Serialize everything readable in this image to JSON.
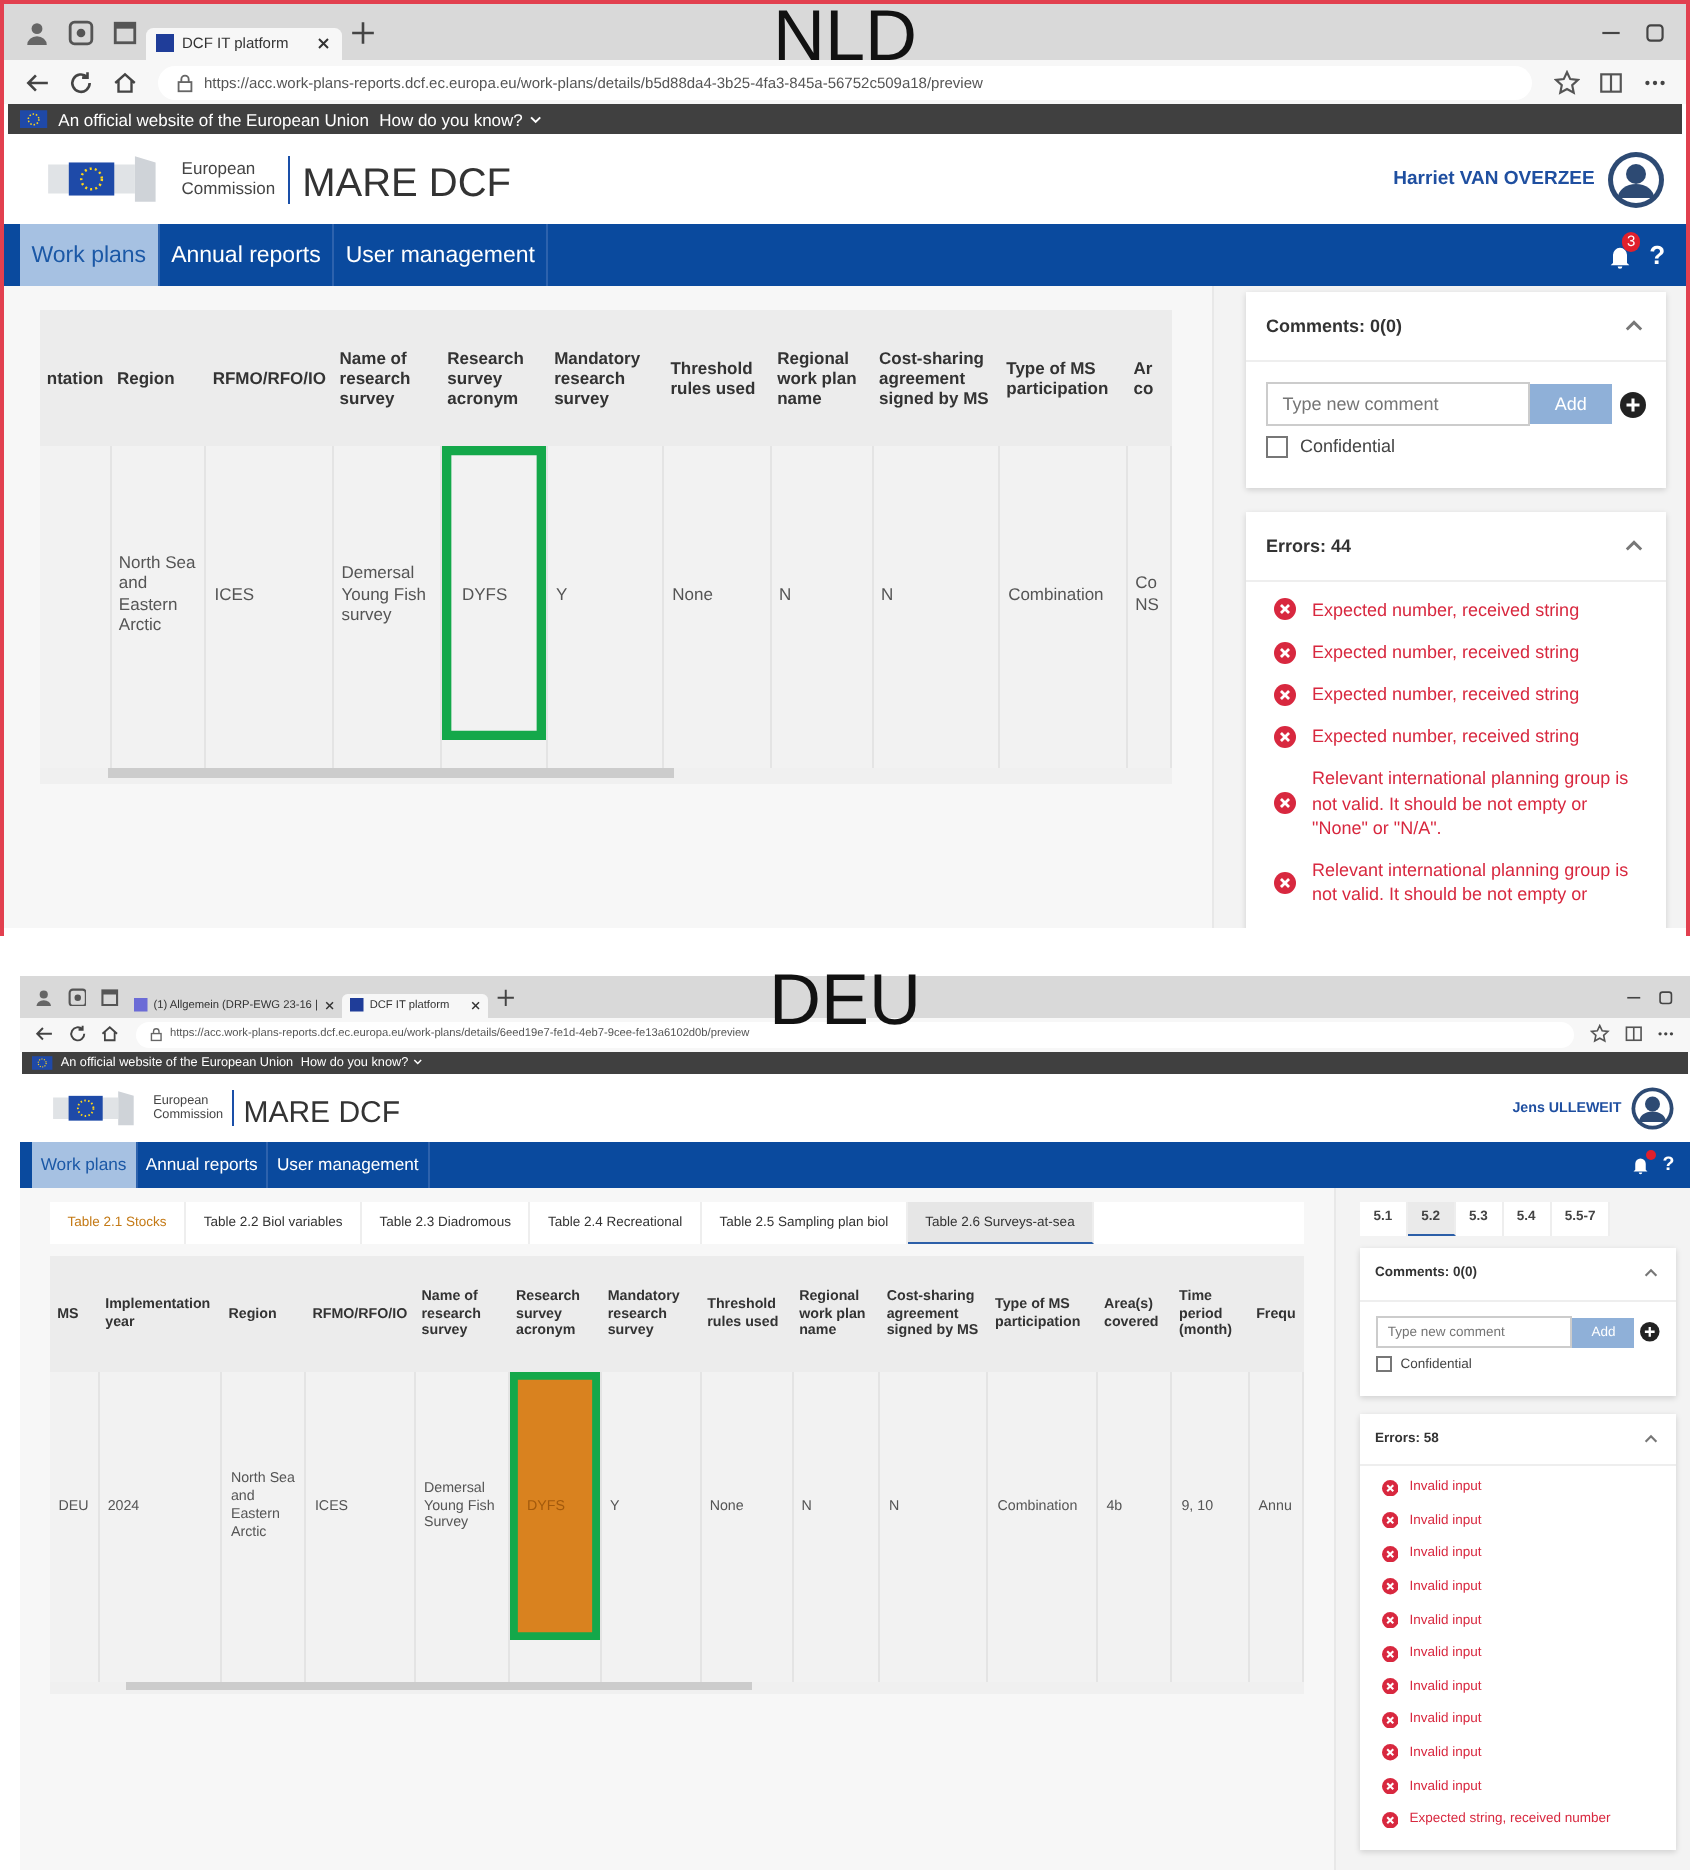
{
  "panels": [
    {
      "label": "NLD",
      "browser": {
        "tabs": [
          {
            "title": "DCF IT platform",
            "selected": true
          }
        ],
        "url": "https://acc.work-plans-reports.dcf.ec.europa.eu/work-plans/details/b5d88da4-3b25-4fa3-845a-56752c509a18/preview"
      },
      "eu_banner": {
        "text": "An official website of the European Union",
        "link": "How do you know?"
      },
      "header": {
        "org_line_1": "European",
        "org_line_2": "Commission",
        "app_title": "MARE DCF",
        "user": "Harriet VAN OVERZEE"
      },
      "nav": {
        "items": [
          {
            "label": "Work plans",
            "selected": true
          },
          {
            "label": "Annual reports",
            "selected": false
          },
          {
            "label": "User management",
            "selected": false
          }
        ],
        "badge": "3",
        "help": "?"
      },
      "table": {
        "columns": [
          "ntation",
          "Region",
          "RFMO/RFO/IO",
          "Name of research survey",
          "Research survey acronym",
          "Mandatory research survey",
          "Threshold rules used",
          "Regional work plan name",
          "Cost-sharing agreement signed by MS",
          "Type of MS participation",
          "Ar co"
        ],
        "rows": [
          {
            "cells": [
              {
                "text": "",
                "marked": false,
                "error": false
              },
              {
                "text": "North Sea and Eastern Arctic",
                "marked": false,
                "error": false
              },
              {
                "text": "ICES",
                "marked": false,
                "error": false
              },
              {
                "text": "Demersal Young Fish survey",
                "marked": false,
                "error": false
              },
              {
                "text": "DYFS",
                "marked": true,
                "error": false
              },
              {
                "text": "Y",
                "marked": false,
                "error": false
              },
              {
                "text": "None",
                "marked": false,
                "error": false
              },
              {
                "text": "N",
                "marked": false,
                "error": false
              },
              {
                "text": "N",
                "marked": false,
                "error": false
              },
              {
                "text": "Combination",
                "marked": false,
                "error": false
              },
              {
                "text": "Co NS",
                "marked": false,
                "error": false
              }
            ]
          }
        ]
      },
      "sidebar": {
        "comments": {
          "title": "Comments: 0(0)",
          "placeholder": "Type new comment",
          "add": "Add",
          "confidential": {
            "label": "Confidential",
            "checked": false
          }
        },
        "errors": {
          "title": "Errors: 44",
          "items": [
            "Expected number, received string",
            "Expected number, received string",
            "Expected number, received string",
            "Expected number, received string",
            "Relevant international planning group is not valid. It should be not empty or \"None\" or \"N/A\".",
            "Relevant international planning group is not valid. It should be not empty or"
          ]
        }
      }
    },
    {
      "label": "DEU",
      "browser": {
        "tabs": [
          {
            "title": "(1) Allgemein (DRP-EWG 23-16 |",
            "selected": false
          },
          {
            "title": "DCF IT platform",
            "selected": true
          }
        ],
        "url": "https://acc.work-plans-reports.dcf.ec.europa.eu/work-plans/details/6eed19e7-fe1d-4eb7-9cee-fe13a6102d0b/preview"
      },
      "eu_banner": {
        "text": "An official website of the European Union",
        "link": "How do you know?"
      },
      "header": {
        "org_line_1": "European",
        "org_line_2": "Commission",
        "app_title": "MARE DCF",
        "user": "Jens ULLEWEIT"
      },
      "nav": {
        "items": [
          {
            "label": "Work plans",
            "selected": true
          },
          {
            "label": "Annual reports",
            "selected": false
          },
          {
            "label": "User management",
            "selected": false
          }
        ],
        "help": "?"
      },
      "table_tabs": [
        {
          "label": "Table 2.1 Stocks",
          "selected": false,
          "has_errors": true
        },
        {
          "label": "Table 2.2 Biol variables",
          "selected": false,
          "has_errors": false
        },
        {
          "label": "Table 2.3 Diadromous",
          "selected": false,
          "has_errors": false
        },
        {
          "label": "Table 2.4 Recreational",
          "selected": false,
          "has_errors": false
        },
        {
          "label": "Table 2.5 Sampling plan biol",
          "selected": false,
          "has_errors": false
        },
        {
          "label": "Table 2.6 Surveys-at-sea",
          "selected": true,
          "has_errors": false
        }
      ],
      "table": {
        "columns": [
          "MS",
          "Implementation year",
          "Region",
          "RFMO/RFO/IO",
          "Name of research survey",
          "Research survey acronym",
          "Mandatory research survey",
          "Threshold rules used",
          "Regional work plan name",
          "Cost-sharing agreement signed by MS",
          "Type of MS participation",
          "Area(s) covered",
          "Time period (month)",
          "Frequ"
        ],
        "rows": [
          {
            "cells": [
              {
                "text": "DEU",
                "marked": false,
                "error": false
              },
              {
                "text": "2024",
                "marked": false,
                "error": false
              },
              {
                "text": "North Sea and Eastern Arctic",
                "marked": false,
                "error": false
              },
              {
                "text": "ICES",
                "marked": false,
                "error": false
              },
              {
                "text": "Demersal Young Fish Survey",
                "marked": false,
                "error": false
              },
              {
                "text": "DYFS",
                "marked": true,
                "error": true
              },
              {
                "text": "Y",
                "marked": false,
                "error": false
              },
              {
                "text": "None",
                "marked": false,
                "error": false
              },
              {
                "text": "N",
                "marked": false,
                "error": false
              },
              {
                "text": "N",
                "marked": false,
                "error": false
              },
              {
                "text": "Combination",
                "marked": false,
                "error": false
              },
              {
                "text": "4b",
                "marked": false,
                "error": false
              },
              {
                "text": "9, 10",
                "marked": false,
                "error": false
              },
              {
                "text": "Annu",
                "marked": false,
                "error": false
              }
            ]
          }
        ]
      },
      "sidebar": {
        "section_tabs": [
          {
            "label": "5.1",
            "selected": false
          },
          {
            "label": "5.2",
            "selected": true
          },
          {
            "label": "5.3",
            "selected": false
          },
          {
            "label": "5.4",
            "selected": false
          },
          {
            "label": "5.5-7",
            "selected": false
          }
        ],
        "comments": {
          "title": "Comments: 0(0)",
          "placeholder": "Type new comment",
          "add": "Add",
          "confidential": {
            "label": "Confidential",
            "checked": false
          }
        },
        "errors": {
          "title": "Errors: 58",
          "items": [
            "Invalid input",
            "Invalid input",
            "Invalid input",
            "Invalid input",
            "Invalid input",
            "Invalid input",
            "Invalid input",
            "Invalid input",
            "Invalid input",
            "Invalid input",
            "Expected string, received number"
          ]
        }
      }
    }
  ]
}
